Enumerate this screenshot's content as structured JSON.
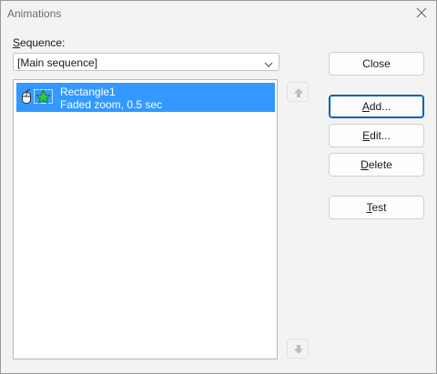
{
  "window": {
    "title": "Animations"
  },
  "sequence": {
    "label_key": "S",
    "label_rest": "equence:",
    "selected": "[Main sequence]"
  },
  "animations": [
    {
      "name": "Rectangle1",
      "detail": "Faded zoom, 0.5 sec"
    }
  ],
  "buttons": {
    "close": "Close",
    "add_key": "A",
    "add_rest": "dd...",
    "edit_key": "E",
    "edit_rest": "dit...",
    "delete_key": "D",
    "delete_rest": "elete",
    "test_key": "T",
    "test_rest": "est"
  },
  "icons": {
    "close": "close-icon",
    "dropdown": "chevron-down-icon",
    "trigger": "mouse-icon",
    "effect": "star-icon",
    "move_up": "arrow-up-icon",
    "move_down": "arrow-down-icon"
  },
  "colors": {
    "selection": "#3399ff",
    "default_border": "#005fb8",
    "star_fill": "#2ecc40"
  }
}
